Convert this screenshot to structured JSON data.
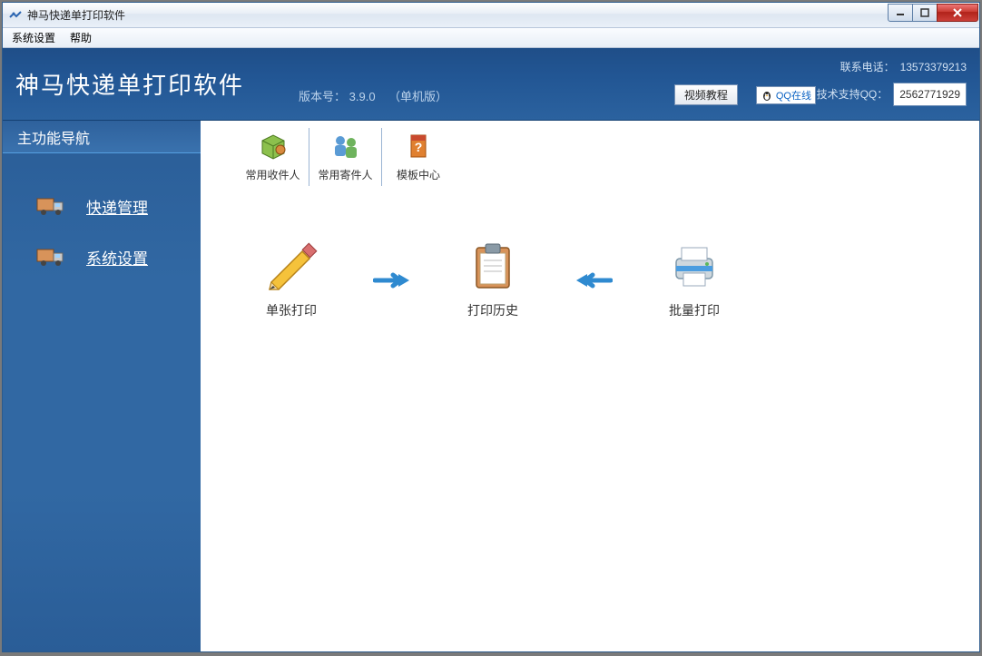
{
  "window": {
    "title": "神马快递单打印软件"
  },
  "menu": {
    "settings": "系统设置",
    "help": "帮助"
  },
  "header": {
    "app_title": "神马快递单打印软件",
    "version_label": "版本号：",
    "version_value": "3.9.0",
    "edition": "（单机版）",
    "contact_label": "联系电话：",
    "contact_value": "13573379213",
    "qq_label": "技术支持QQ：",
    "qq_value": "2562771929",
    "video_btn": "视频教程",
    "qq_online": "QQ在线"
  },
  "sidebar": {
    "title": "主功能导航",
    "items": [
      {
        "label": "快递管理"
      },
      {
        "label": "系统设置"
      }
    ]
  },
  "toolbar": {
    "items": [
      {
        "label": "常用收件人"
      },
      {
        "label": "常用寄件人"
      },
      {
        "label": "模板中心"
      }
    ]
  },
  "flow": {
    "single_print": "单张打印",
    "history": "打印历史",
    "batch_print": "批量打印"
  }
}
